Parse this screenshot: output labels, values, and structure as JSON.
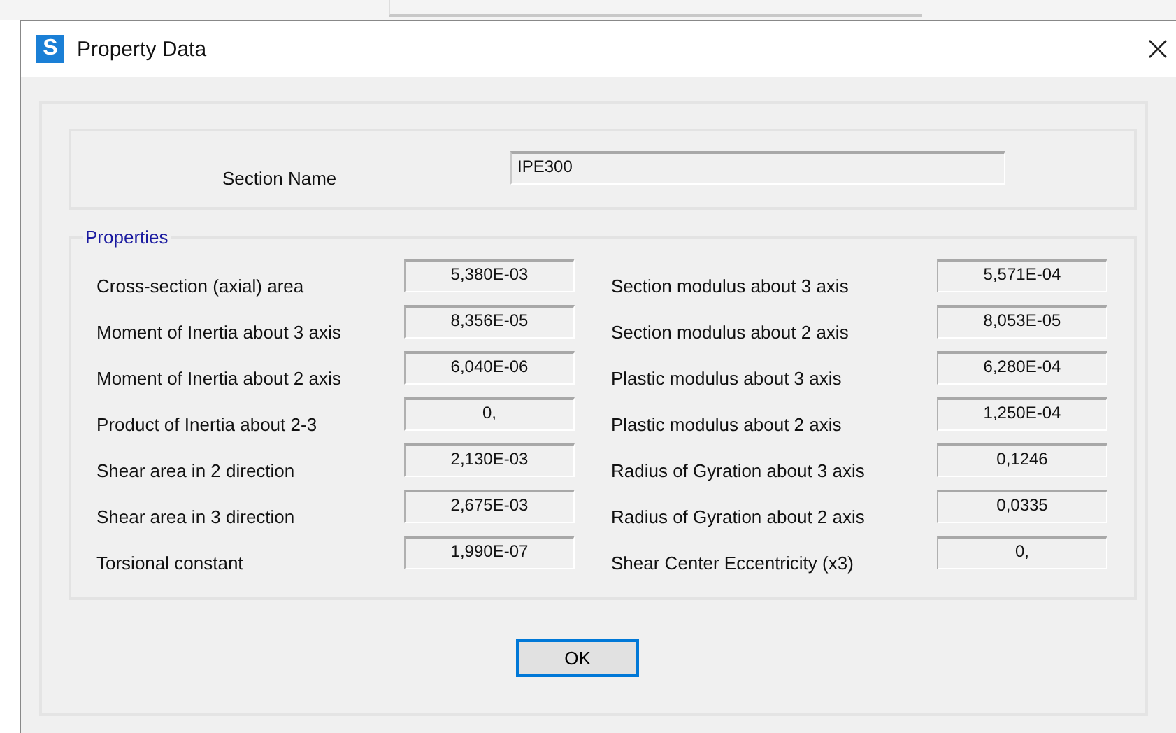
{
  "window": {
    "title": "Property Data",
    "icon": "S"
  },
  "section_name": {
    "label": "Section Name",
    "value": "IPE300"
  },
  "properties": {
    "title": "Properties",
    "left": [
      {
        "label": "Cross-section (axial) area",
        "value": "5,380E-03"
      },
      {
        "label": "Moment of Inertia about 3 axis",
        "value": "8,356E-05"
      },
      {
        "label": "Moment of Inertia about 2 axis",
        "value": "6,040E-06"
      },
      {
        "label": "Product of Inertia about 2-3",
        "value": "0,"
      },
      {
        "label": "Shear area in 2 direction",
        "value": "2,130E-03"
      },
      {
        "label": "Shear area in 3 direction",
        "value": "2,675E-03"
      },
      {
        "label": "Torsional constant",
        "value": "1,990E-07"
      }
    ],
    "right": [
      {
        "label": "Section modulus about 3 axis",
        "value": "5,571E-04"
      },
      {
        "label": "Section modulus about 2 axis",
        "value": "8,053E-05"
      },
      {
        "label": "Plastic modulus about 3 axis",
        "value": "6,280E-04"
      },
      {
        "label": "Plastic modulus about 2 axis",
        "value": "1,250E-04"
      },
      {
        "label": "Radius of Gyration about 3 axis",
        "value": "0,1246"
      },
      {
        "label": "Radius of Gyration about 2 axis",
        "value": "0,0335"
      },
      {
        "label": "Shear Center Eccentricity (x3)",
        "value": "0,"
      }
    ]
  },
  "buttons": [
    {
      "label": "OK",
      "focused": true
    }
  ]
}
